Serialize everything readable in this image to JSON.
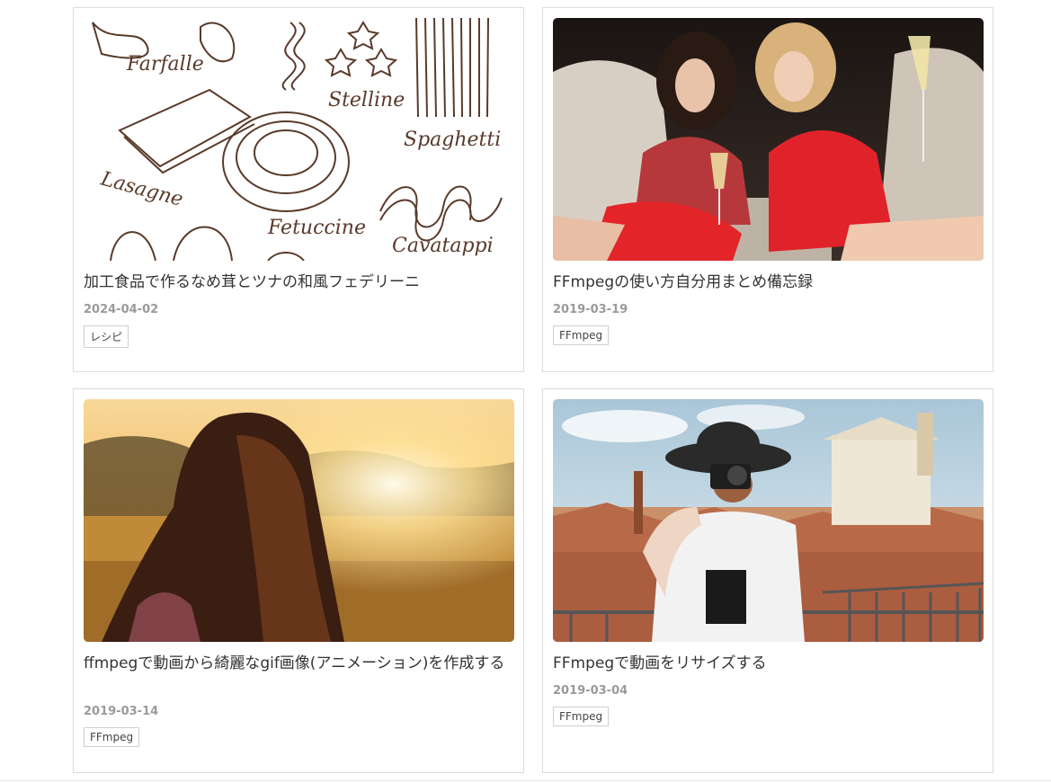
{
  "articles": [
    {
      "title": "加工食品で作るなめ茸とツナの和風フェデリーニ",
      "date": "2024-04-02",
      "tag": "レシピ",
      "image": {
        "type": "pasta-illustration",
        "labels": [
          "Farfalle",
          "Stelline",
          "Spaghetti",
          "Lasagne",
          "Fetuccine",
          "Cavatappi"
        ]
      }
    },
    {
      "title": "FFmpegの使い方自分用まとめ備忘録",
      "date": "2019-03-19",
      "tag": "FFmpeg",
      "image": {
        "type": "photo-women-in-car"
      }
    },
    {
      "title": "ffmpegで動画から綺麗なgif画像(アニメーション)を作成する",
      "date": "2019-03-14",
      "tag": "FFmpeg",
      "image": {
        "type": "photo-sunset-field"
      }
    },
    {
      "title": "FFmpegで動画をリサイズする",
      "date": "2019-03-04",
      "tag": "FFmpeg",
      "image": {
        "type": "photo-photographer-city"
      }
    }
  ],
  "colors": {
    "card_border": "#dcdcdc",
    "title_text": "#333333",
    "date_text": "#9a9a9a",
    "sketch_ink": "#5a3a2a"
  }
}
